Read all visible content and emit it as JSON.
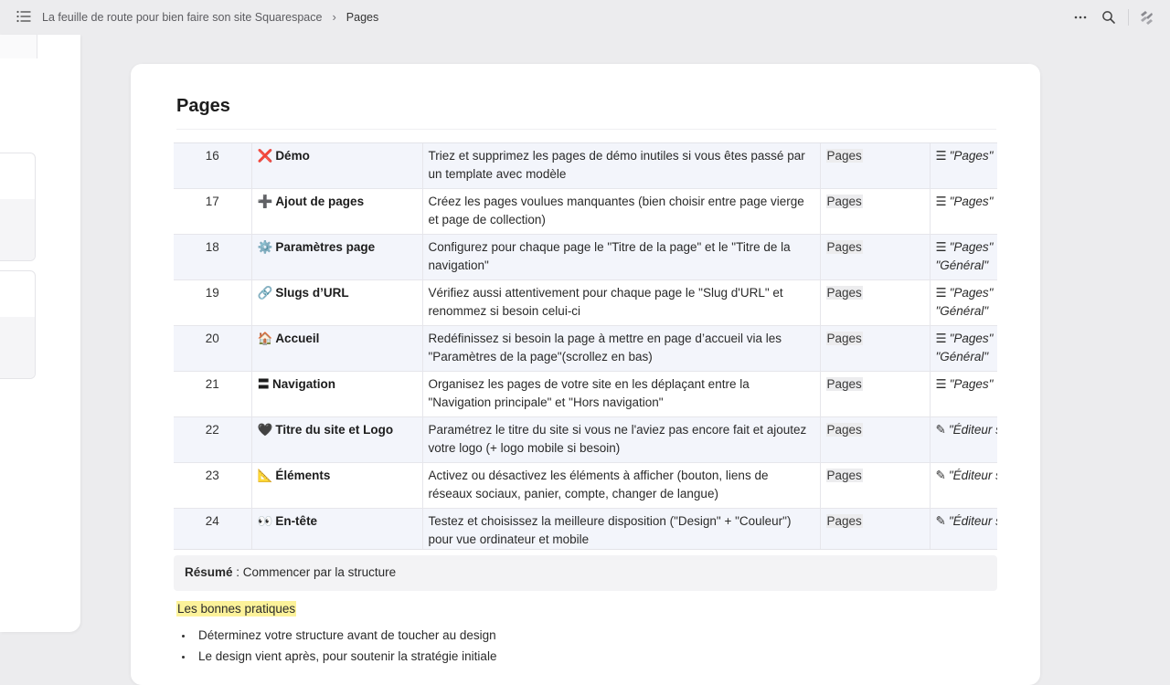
{
  "topbar": {
    "breadcrumb_doc": "La feuille de route pour bien faire son site Squarespace",
    "breadcrumb_separator": "›",
    "breadcrumb_current": "Pages"
  },
  "page": {
    "title": "Pages"
  },
  "table": {
    "rows": [
      {
        "num": "16",
        "icon": "❌",
        "name": "Démo",
        "desc": "Triez et supprimez les pages de démo inutiles si vous êtes passé par un template avec modèle",
        "cat": "Pages",
        "loc_icon": "☰",
        "loc": "\"Pages\""
      },
      {
        "num": "17",
        "icon": "➕",
        "name": "Ajout de pages",
        "desc": "Créez les pages voulues manquantes (bien choisir entre page vierge et page de collection)",
        "cat": "Pages",
        "loc_icon": "☰",
        "loc": "\"Pages\""
      },
      {
        "num": "18",
        "icon": "⚙️",
        "name": "Paramètres page",
        "desc": "Configurez pour chaque page le \"Titre de la page\" et le \"Titre de la navigation\"",
        "cat": "Pages",
        "loc_icon": "☰",
        "loc": "\"Pages\" > \"Général\""
      },
      {
        "num": "19",
        "icon": "🔗",
        "name": "Slugs d’URL",
        "desc": "Vérifiez aussi attentivement pour chaque page le \"Slug d'URL\" et renommez si besoin celui-ci",
        "cat": "Pages",
        "loc_icon": "☰",
        "loc": "\"Pages\" > \"Général\""
      },
      {
        "num": "20",
        "icon": "🏠",
        "name": "Accueil",
        "desc": "Redéfinissez si besoin la page à mettre en page d’accueil via les \"Paramètres de la page\"(scrollez en bas)",
        "cat": "Pages",
        "loc_icon": "☰",
        "loc": "\"Pages\" > \"Général\""
      },
      {
        "num": "21",
        "icon": "〓",
        "name": "Navigation",
        "desc": "Organisez les pages de votre site en les déplaçant entre la \"Navigation principale\" et \"Hors navigation\"",
        "cat": "Pages",
        "loc_icon": "☰",
        "loc": "\"Pages\""
      },
      {
        "num": "22",
        "icon": "🖤",
        "name": "Titre du site et Logo",
        "desc": "Paramétrez le titre du site si vous ne l'aviez pas encore fait et ajoutez votre logo (+ logo mobile si besoin)",
        "cat": "Pages",
        "loc_icon": "✎",
        "loc": "\"Éditeur site\""
      },
      {
        "num": "23",
        "icon": "📐",
        "name": "Éléments",
        "desc": "Activez ou désactivez les éléments à afficher (bouton, liens de réseaux sociaux, panier, compte, changer de langue)",
        "cat": "Pages",
        "loc_icon": "✎",
        "loc": "\"Éditeur site\""
      },
      {
        "num": "24",
        "icon": "👀",
        "name": "En-tête",
        "desc": "Testez et choisissez la meilleure disposition (\"Design\" + \"Couleur\") pour vue ordinateur et mobile",
        "cat": "Pages",
        "loc_icon": "✎",
        "loc": "\"Éditeur site\""
      }
    ]
  },
  "summary": {
    "label": "Résumé",
    "text": " : Commencer par la structure"
  },
  "practices": {
    "heading": "Les bonnes pratiques",
    "items": [
      "Déterminez votre structure avant de toucher au design",
      "Le design vient après, pour soutenir la stratégie initiale"
    ]
  },
  "colors": {
    "background": "#ececee",
    "highlight": "#fcf29a",
    "row_alt": "#f3f5fb"
  }
}
